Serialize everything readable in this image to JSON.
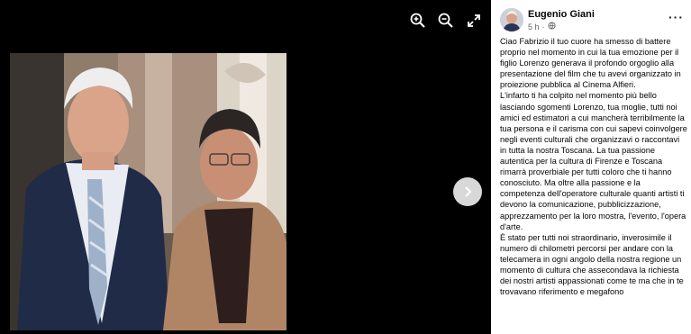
{
  "viewer": {
    "photo_alt": "",
    "icons": [
      "zoom-in-icon",
      "zoom-out-icon",
      "fullscreen-icon",
      "chevron-right-icon"
    ]
  },
  "post": {
    "author": "Eugenio Giani",
    "time": "5 h",
    "separator": "·",
    "more_label": "···",
    "text": "Ciao Fabrizio il tuo cuore ha smesso di battere proprio nel momento in cui la tua emozione per il figlio Lorenzo generava il profondo orgoglio alla presentazione del film che tu avevi organizzato in proiezione pubblica al Cinema Alfieri.\nL'infarto ti ha colpito nel momento più bello lasciando sgomenti Lorenzo, tua moglie, tutti noi amici ed estimatori a cui mancherà terribilmente la tua persona e il carisma con cui sapevi coinvolgere negli eventi culturali che organizzavi o raccontavi in tutta la nostra Toscana. La tua passione autentica per la cultura di Firenze e Toscana rimarrà proverbiale per tutti coloro che ti hanno conosciuto. Ma oltre alla passione e la competenza dell'operatore culturale quanti artisti ti devono la comunicazione, pubblicizzazione, apprezzamento per la loro mostra, l'evento, l'opera d'arte.\nÈ stato per tutti noi straordinario, inverosimile il numero di chilometri percorsi per andare con la telecamera in ogni angolo della nostra regione un momento di cultura che assecondava la richiesta dei nostri artisti appassionati come te ma che in te trovavano riferimento e megafono"
  }
}
